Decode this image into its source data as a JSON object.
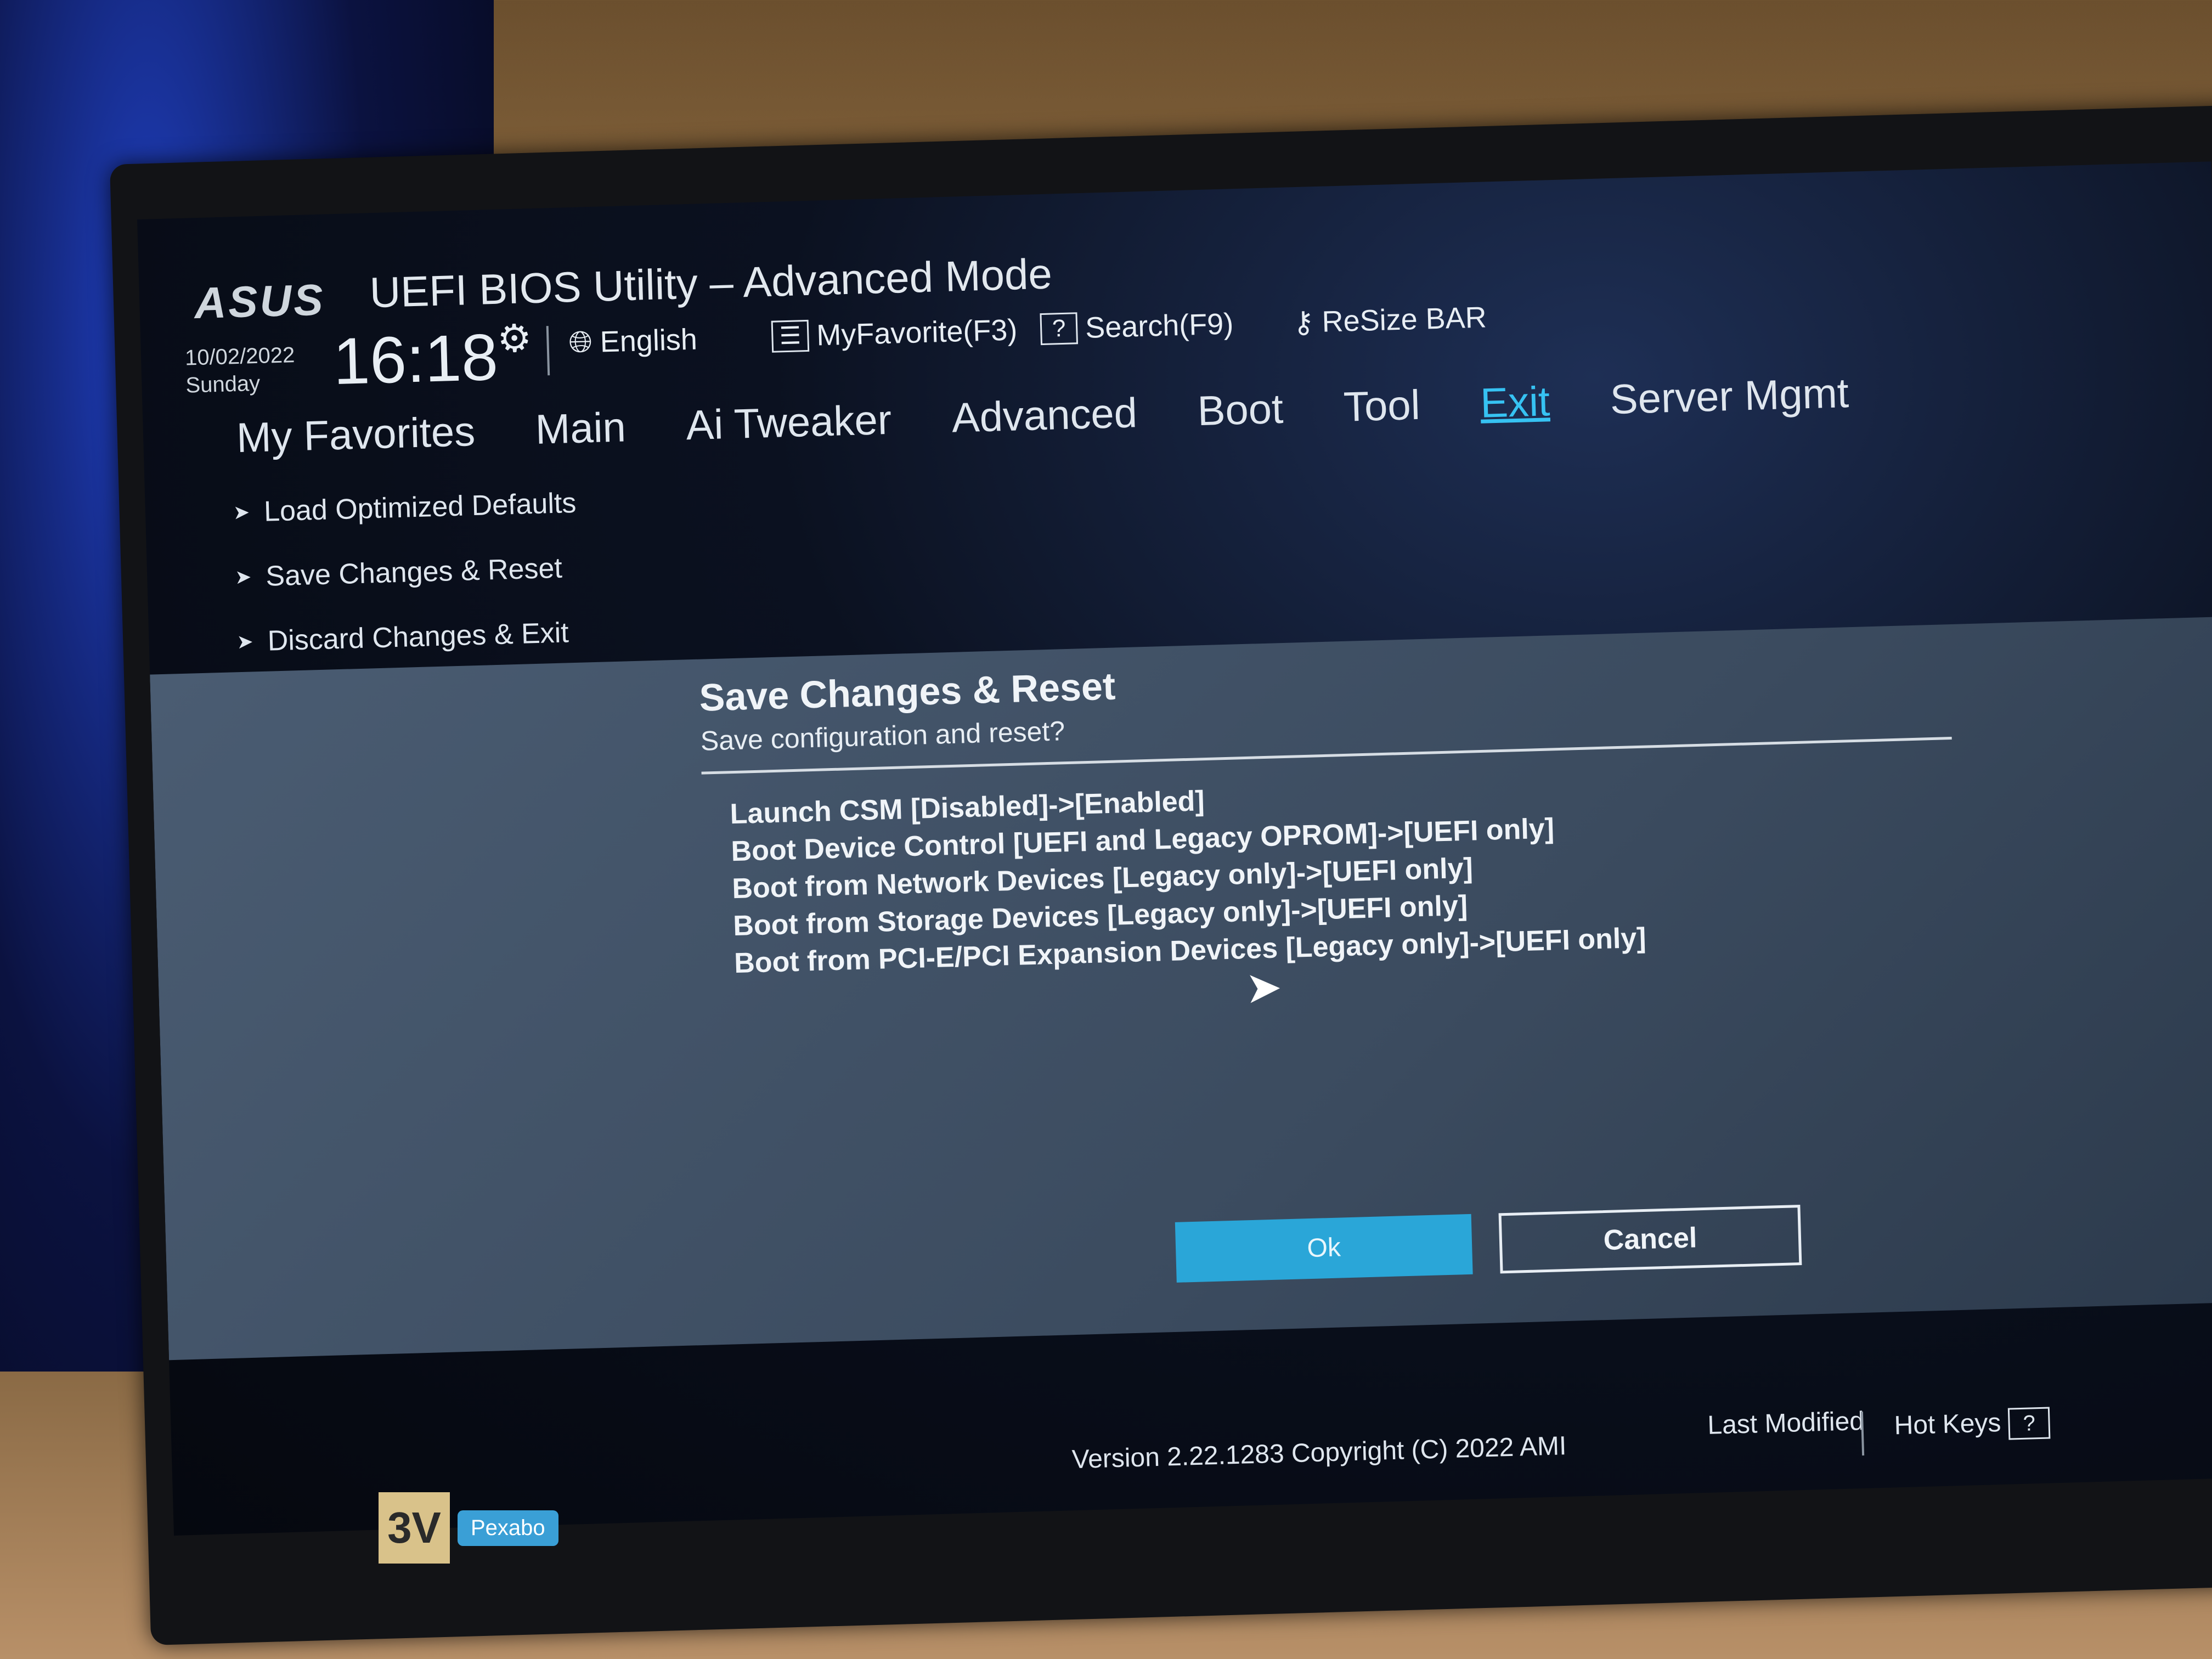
{
  "header": {
    "logo_text": "ASUS",
    "title": "UEFI BIOS Utility – Advanced Mode",
    "date": "10/02/2022",
    "weekday": "Sunday",
    "time": "16:18",
    "language": "English",
    "favorite_label": "MyFavorite(F3)",
    "search_label": "Search(F9)",
    "resize_bar_label": "ReSize BAR"
  },
  "nav": {
    "tabs": [
      "My Favorites",
      "Main",
      "Ai Tweaker",
      "Advanced",
      "Boot",
      "Tool",
      "Exit",
      "Server Mgmt"
    ],
    "active_tab": "Exit"
  },
  "exit_menu": {
    "items": [
      "Load Optimized Defaults",
      "Save Changes & Reset",
      "Discard Changes & Exit"
    ]
  },
  "dialog": {
    "title": "Save Changes & Reset",
    "subtitle": "Save configuration and reset?",
    "changes": [
      "Launch CSM [Disabled]->[Enabled]",
      "Boot Device Control [UEFI and Legacy OPROM]->[UEFI only]",
      "Boot from Network Devices [Legacy only]->[UEFI only]",
      "Boot from Storage Devices [Legacy only]->[UEFI only]",
      "Boot from PCI-E/PCI Expansion Devices [Legacy only]->[UEFI only]"
    ],
    "ok_label": "Ok",
    "cancel_label": "Cancel"
  },
  "footer": {
    "version": "Version 2.22.1283 Copyright (C) 2022 AMI",
    "last_modified": "Last Modified",
    "hot_keys": "Hot Keys",
    "hot_keys_key": "?"
  },
  "watermark": {
    "logo": "3V",
    "tag": "Pexabo"
  },
  "colors": {
    "accent": "#2aa6d8",
    "active_tab": "#36c2f2",
    "dialog_bg": "#3b4b5f"
  }
}
